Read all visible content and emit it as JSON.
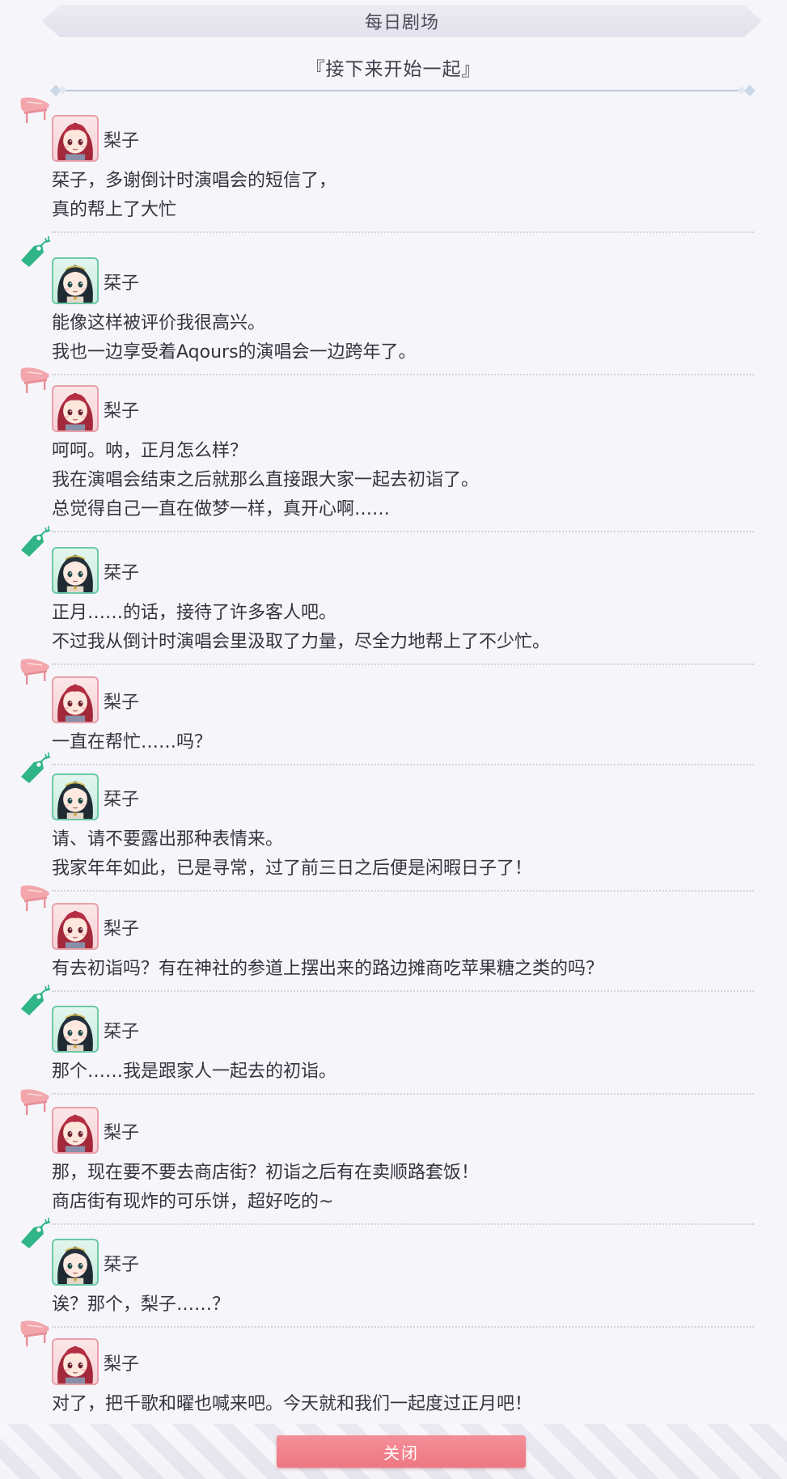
{
  "header": {
    "title": "每日剧场",
    "subtitle": "『接下来开始一起』"
  },
  "dialog": [
    {
      "speaker": "梨子",
      "character": "riko",
      "badge_icon": "piano-icon",
      "lines": [
        "栞子，多谢倒计时演唱会的短信了，",
        "真的帮上了大忙"
      ]
    },
    {
      "speaker": "栞子",
      "character": "shioriko",
      "badge_icon": "tag-icon",
      "lines": [
        "能像这样被评价我很高兴。",
        "我也一边享受着Aqours的演唱会一边跨年了。"
      ]
    },
    {
      "speaker": "梨子",
      "character": "riko",
      "badge_icon": "piano-icon",
      "lines": [
        "呵呵。呐，正月怎么样？",
        "我在演唱会结束之后就那么直接跟大家一起去初诣了。",
        "总觉得自己一直在做梦一样，真开心啊……"
      ]
    },
    {
      "speaker": "栞子",
      "character": "shioriko",
      "badge_icon": "tag-icon",
      "lines": [
        "正月……的话，接待了许多客人吧。",
        "不过我从倒计时演唱会里汲取了力量，尽全力地帮上了不少忙。"
      ]
    },
    {
      "speaker": "梨子",
      "character": "riko",
      "badge_icon": "piano-icon",
      "lines": [
        "一直在帮忙……吗？"
      ]
    },
    {
      "speaker": "栞子",
      "character": "shioriko",
      "badge_icon": "tag-icon",
      "lines": [
        "请、请不要露出那种表情来。",
        "我家年年如此，已是寻常，过了前三日之后便是闲暇日子了！"
      ]
    },
    {
      "speaker": "梨子",
      "character": "riko",
      "badge_icon": "piano-icon",
      "lines": [
        "有去初诣吗？有在神社的参道上摆出来的路边摊商吃苹果糖之类的吗？"
      ]
    },
    {
      "speaker": "栞子",
      "character": "shioriko",
      "badge_icon": "tag-icon",
      "lines": [
        "那个……我是跟家人一起去的初诣。"
      ]
    },
    {
      "speaker": "梨子",
      "character": "riko",
      "badge_icon": "piano-icon",
      "lines": [
        "那，现在要不要去商店街？初诣之后有在卖顺路套饭！",
        "商店街有现炸的可乐饼，超好吃的~"
      ]
    },
    {
      "speaker": "栞子",
      "character": "shioriko",
      "badge_icon": "tag-icon",
      "lines": [
        "诶？那个，梨子……？"
      ]
    },
    {
      "speaker": "梨子",
      "character": "riko",
      "badge_icon": "piano-icon",
      "lines": [
        "对了，把千歌和曜也喊来吧。今天就和我们一起度过正月吧！"
      ]
    }
  ],
  "footer": {
    "close_label": "关闭"
  },
  "colors": {
    "close_button": "#f0808b",
    "riko_accent": "#e8a0a8",
    "shioriko_accent": "#2fb586"
  }
}
